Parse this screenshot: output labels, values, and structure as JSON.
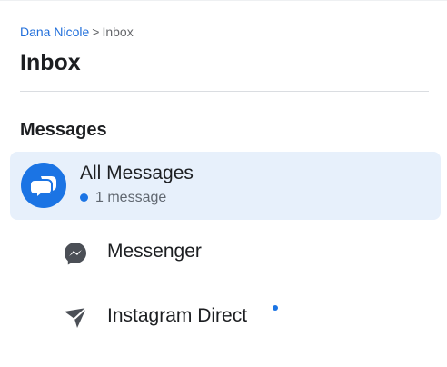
{
  "breadcrumb": {
    "account": "Dana Nicole",
    "separator": ">",
    "current": "Inbox"
  },
  "page": {
    "title": "Inbox"
  },
  "messages_section": {
    "title": "Messages",
    "items": [
      {
        "label": "All Messages",
        "icon": "chat-bubbles-icon",
        "active": true,
        "status": "1 message"
      },
      {
        "label": "Messenger",
        "icon": "messenger-icon",
        "active": false
      },
      {
        "label": "Instagram Direct",
        "icon": "instagram-direct-icon",
        "active": false,
        "unread": true
      }
    ]
  },
  "colors": {
    "accent": "#1b74e4",
    "link": "#216fdb",
    "active_bg": "#e7f0fb",
    "text_primary": "#1c1e21",
    "text_secondary": "#606770"
  }
}
